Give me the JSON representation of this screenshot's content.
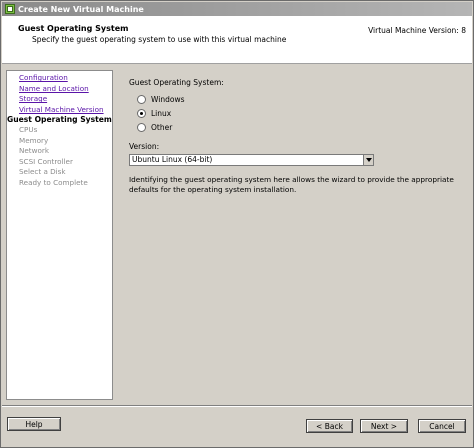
{
  "window": {
    "title": "Create New Virtual Machine",
    "title_icon": "vm-wizard-icon"
  },
  "header": {
    "title": "Guest Operating System",
    "subtitle": "Specify the guest operating system to use with this virtual machine",
    "version": "Virtual Machine Version: 8"
  },
  "sidebar": {
    "items": [
      {
        "label": "Configuration",
        "state": "link"
      },
      {
        "label": "Name and Location",
        "state": "link"
      },
      {
        "label": "Storage",
        "state": "link"
      },
      {
        "label": "Virtual Machine Version",
        "state": "link"
      },
      {
        "label": "Guest Operating System",
        "state": "current"
      },
      {
        "label": "CPUs",
        "state": "disabled"
      },
      {
        "label": "Memory",
        "state": "disabled"
      },
      {
        "label": "Network",
        "state": "disabled"
      },
      {
        "label": "SCSI Controller",
        "state": "disabled"
      },
      {
        "label": "Select a Disk",
        "state": "disabled"
      },
      {
        "label": "Ready to Complete",
        "state": "disabled"
      }
    ]
  },
  "main": {
    "os_label": "Guest Operating System:",
    "os_options": [
      {
        "label": "Windows",
        "checked": false
      },
      {
        "label": "Linux",
        "checked": true
      },
      {
        "label": "Other",
        "checked": false
      }
    ],
    "version_label": "Version:",
    "version_value": "Ubuntu Linux (64-bit)",
    "description": "Identifying the guest operating system here allows the wizard to provide the appropriate defaults for the operating system installation."
  },
  "footer": {
    "help_label": "Help",
    "back_label": "< Back",
    "next_label": "Next >",
    "cancel_label": "Cancel"
  },
  "colors": {
    "link": "#5a14a8",
    "disabled": "#8c8c8c",
    "background": "#d4d0c8"
  }
}
